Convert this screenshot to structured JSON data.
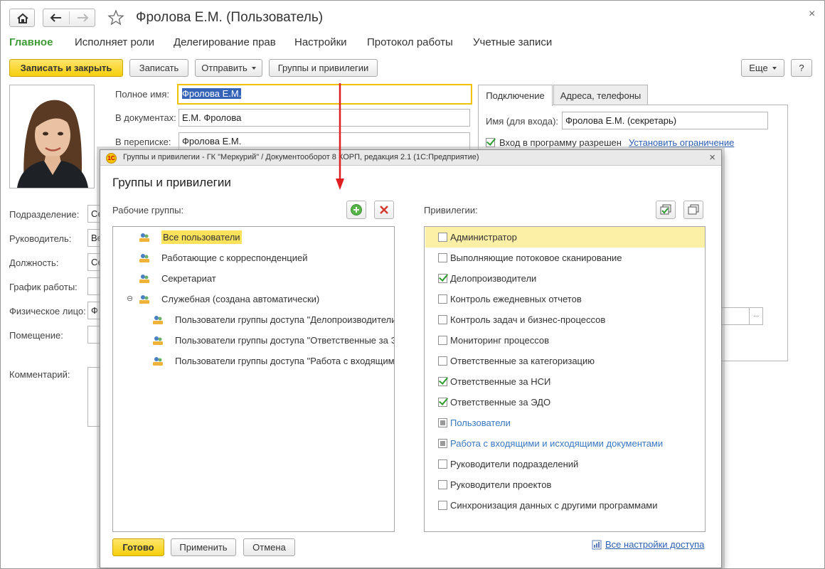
{
  "window": {
    "title": "Фролова Е.М. (Пользователь)",
    "close": "×"
  },
  "sections": [
    "Главное",
    "Исполняет роли",
    "Делегирование прав",
    "Настройки",
    "Протокол работы",
    "Учетные записи"
  ],
  "toolbar": {
    "save_close": "Записать и закрыть",
    "save": "Записать",
    "send": "Отправить",
    "groups": "Группы и привилегии",
    "more": "Еще",
    "help": "?"
  },
  "form": {
    "full_name_label": "Полное имя:",
    "full_name_value": "Фролова Е.М.",
    "in_docs_label": "В документах:",
    "in_docs_value": "Е.М. Фролова",
    "in_corr_label": "В переписке:",
    "in_corr_value": "Фролова Е.М.",
    "department_label": "Подразделение:",
    "department_value": "Се",
    "manager_label": "Руководитель:",
    "manager_value": "Ве",
    "position_label": "Должность:",
    "position_value": "Се",
    "schedule_label": "График работы:",
    "person_label": "Физическое лицо:",
    "person_value": "Ф",
    "room_label": "Помещение:",
    "comment_label": "Комментарий:"
  },
  "tabs": {
    "connection": "Подключение",
    "addresses": "Адреса, телефоны",
    "login_label": "Имя (для входа):",
    "login_value": "Фролова Е.М. (секретарь)",
    "login_allowed": "Вход в программу разрешен",
    "set_restriction": "Установить ограничение",
    "ellipsis": "..."
  },
  "dialog": {
    "title": "Группы и привилегии - ГК \"Меркурий\" / Документооборот 8 КОРП, редакция 2.1  (1С:Предприятие)",
    "close": "×",
    "heading": "Группы и привилегии",
    "work_groups_label": "Рабочие группы:",
    "privileges_label": "Привилегии:",
    "groups": [
      "Все пользователи",
      "Работающие с корреспонденцией",
      "Секретариат",
      "Служебная (создана автоматически)",
      "Пользователи группы доступа \"Делопроизводители",
      "Пользователи группы доступа \"Ответственные за Э",
      "Пользователи группы доступа \"Работа с входящим"
    ],
    "expander": "⊖",
    "privileges": [
      {
        "label": "Администратор",
        "state": "unchecked"
      },
      {
        "label": "Выполняющие потоковое сканирование",
        "state": "unchecked"
      },
      {
        "label": "Делопроизводители",
        "state": "checked"
      },
      {
        "label": "Контроль ежедневных отчетов",
        "state": "unchecked"
      },
      {
        "label": "Контроль задач и бизнес-процессов",
        "state": "unchecked"
      },
      {
        "label": "Мониторинг процессов",
        "state": "unchecked"
      },
      {
        "label": "Ответственные за категоризацию",
        "state": "unchecked"
      },
      {
        "label": "Ответственные за НСИ",
        "state": "checked"
      },
      {
        "label": "Ответственные за ЭДО",
        "state": "checked"
      },
      {
        "label": "Пользователи",
        "state": "partial"
      },
      {
        "label": "Работа с входящими и исходящими документами",
        "state": "partial"
      },
      {
        "label": "Руководители подразделений",
        "state": "unchecked"
      },
      {
        "label": "Руководители проектов",
        "state": "unchecked"
      },
      {
        "label": "Синхронизация данных с другими программами",
        "state": "unchecked"
      }
    ],
    "ok": "Готово",
    "apply": "Применить",
    "cancel": "Отмена",
    "all_access": "Все настройки доступа"
  },
  "colors": {
    "accent_green": "#3f9c35",
    "button_yellow": "#f6cf0c",
    "selection_yellow": "#fcefa6",
    "link_blue": "#2c5fb3",
    "arrow_red": "#e02020"
  }
}
